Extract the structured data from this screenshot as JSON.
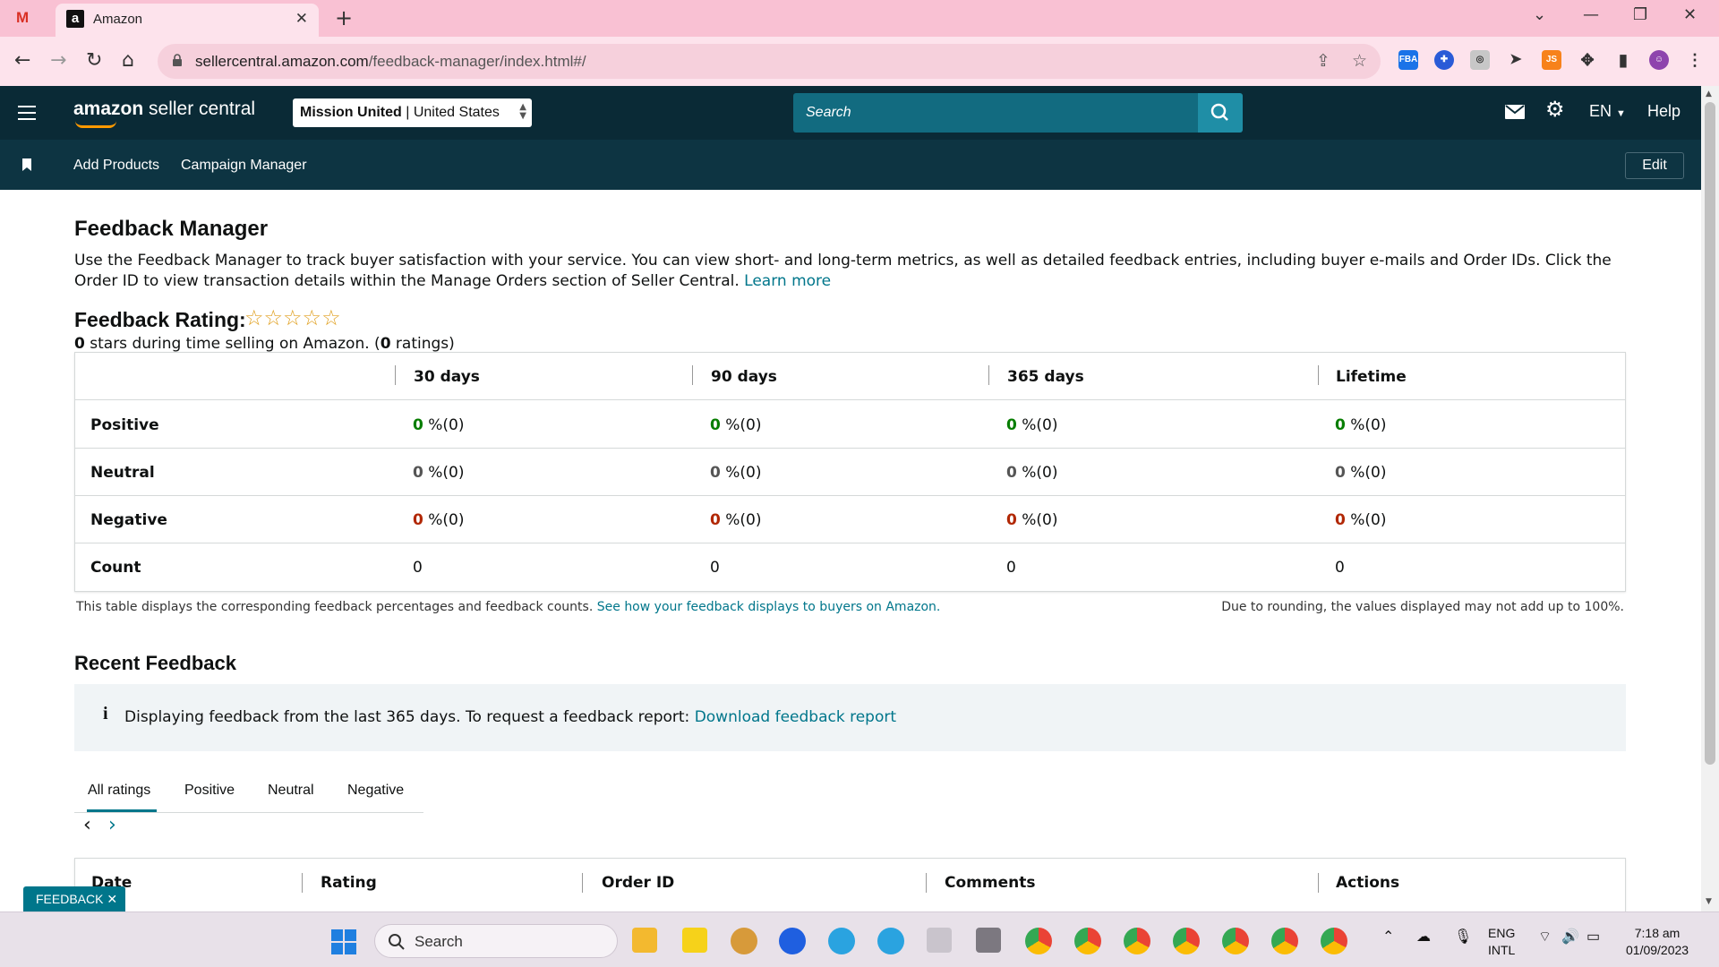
{
  "browser": {
    "tab_title": "Amazon",
    "tab_favicon": "a",
    "gmail_label": "M",
    "new_tab": "+",
    "url_host": "sellercentral.amazon.com",
    "url_path": "/feedback-manager/index.html#/"
  },
  "header": {
    "brand_bold": "amazon",
    "brand_rest": " seller central",
    "account_name": "Mission United",
    "account_separator": " | ",
    "account_region": "United States",
    "search_placeholder": "Search",
    "language": "EN",
    "help": "Help"
  },
  "subnav": {
    "links": [
      "Add Products",
      "Campaign Manager"
    ],
    "edit": "Edit"
  },
  "page": {
    "title": "Feedback Manager",
    "intro": "Use the Feedback Manager to track buyer satisfaction with your service. You can view short- and long-term metrics, as well as detailed feedback entries, including buyer e-mails and Order IDs. Click the Order ID to view transaction details within the Manage Orders section of Seller Central.",
    "learn_more": "Learn more",
    "rating_title": "Feedback Rating:",
    "stars": "☆☆☆☆☆",
    "rating_stars_value": "0",
    "rating_sub_a": " stars during time selling on Amazon. (",
    "rating_count": "0",
    "rating_sub_b": " ratings)"
  },
  "feedback_table": {
    "columns": [
      "30 days",
      "90 days",
      "365 days",
      "Lifetime"
    ],
    "rows": [
      {
        "label": "Positive",
        "cells": [
          [
            "0",
            " %(0)"
          ],
          [
            "0",
            " %(0)"
          ],
          [
            "0",
            " %(0)"
          ],
          [
            "0",
            " %(0)"
          ]
        ]
      },
      {
        "label": "Neutral",
        "cells": [
          [
            "0",
            " %(0)"
          ],
          [
            "0",
            " %(0)"
          ],
          [
            "0",
            " %(0)"
          ],
          [
            "0",
            " %(0)"
          ]
        ]
      },
      {
        "label": "Negative",
        "cells": [
          [
            "0",
            " %(0)"
          ],
          [
            "0",
            " %(0)"
          ],
          [
            "0",
            " %(0)"
          ],
          [
            "0",
            " %(0)"
          ]
        ]
      },
      {
        "label": "Count",
        "cells": [
          [
            "",
            "0"
          ],
          [
            "",
            "0"
          ],
          [
            "",
            "0"
          ],
          [
            "",
            "0"
          ]
        ]
      }
    ],
    "note": "This table displays the corresponding feedback percentages and feedback counts.",
    "note_link": "See how your feedback displays to buyers on Amazon.",
    "note_right": "Due to rounding, the values displayed may not add up to 100%."
  },
  "recent": {
    "title": "Recent Feedback",
    "info_icon": "i",
    "info_text": "Displaying feedback from the last 365 days. To request a feedback report:",
    "info_link": "Download feedback report",
    "tabs": [
      "All ratings",
      "Positive",
      "Neutral",
      "Negative"
    ],
    "prev": "‹",
    "next": "›",
    "columns": [
      "Date",
      "Rating",
      "Order ID",
      "Comments",
      "Actions"
    ]
  },
  "feedback_widget": "FEEDBACK ✕",
  "taskbar": {
    "search": "Search",
    "lang_top": "ENG",
    "lang_bottom": "INTL",
    "time": "7:18 am",
    "date": "01/09/2023"
  },
  "colors": {
    "header_bg": "#0a2a36",
    "subnav_bg": "#0d3442",
    "search_bg": "#126b80",
    "link": "#00768b",
    "positive": "#067d00",
    "negative": "#b12704",
    "tab_bar": "#f9c1d3"
  }
}
